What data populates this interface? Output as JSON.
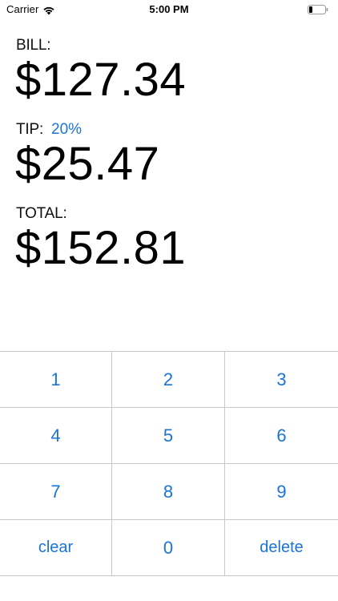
{
  "status_bar": {
    "carrier": "Carrier",
    "time": "5:00 PM",
    "wifi_icon": "wifi-icon",
    "battery_icon": "battery-icon"
  },
  "display": {
    "bill_label": "BILL:",
    "bill_amount": "$127.34",
    "tip_label": "TIP:",
    "tip_percent": "20%",
    "tip_amount": "$25.47",
    "total_label": "TOTAL:",
    "total_amount": "$152.81"
  },
  "keypad": {
    "keys": [
      "1",
      "2",
      "3",
      "4",
      "5",
      "6",
      "7",
      "8",
      "9",
      "clear",
      "0",
      "delete"
    ]
  },
  "colors": {
    "accent": "#1a73d6",
    "divider": "#c8c8cc",
    "text": "#000000",
    "background": "#ffffff"
  }
}
